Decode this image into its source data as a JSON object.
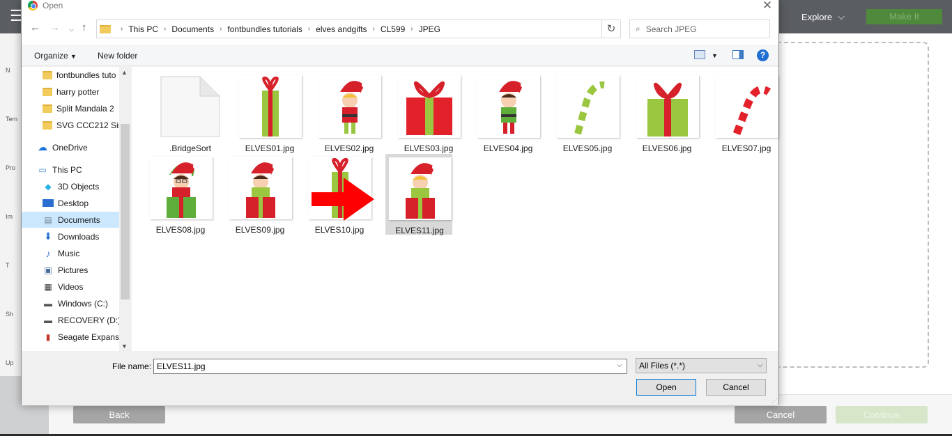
{
  "background_app": {
    "explore_label": "Explore",
    "make_it_label": "Make It",
    "sidebar_labels": [
      "N",
      "Tem",
      "Pro",
      "Im",
      "T",
      "Sh",
      "Up"
    ],
    "back_label": "Back",
    "cancel_label": "Cancel",
    "continue_label": "Continue"
  },
  "dialog": {
    "title": "Open",
    "breadcrumb": [
      "This PC",
      "Documents",
      "fontbundles tutorials",
      "elves andgifts",
      "CL599",
      "JPEG"
    ],
    "search_placeholder": "Search JPEG",
    "toolbar": {
      "organize": "Organize",
      "new_folder": "New folder"
    },
    "nav_items": [
      {
        "label": "fontbundles tuto",
        "icon": "folder-icon"
      },
      {
        "label": "harry potter",
        "icon": "folder-icon"
      },
      {
        "label": "Split Mandala 2",
        "icon": "folder-icon"
      },
      {
        "label": "SVG CCC212 Sin",
        "icon": "folder-icon"
      },
      {
        "label": "OneDrive",
        "icon": "cloud-icon"
      },
      {
        "label": "This PC",
        "icon": "computer-icon"
      },
      {
        "label": "3D Objects",
        "icon": "cube-icon"
      },
      {
        "label": "Desktop",
        "icon": "desktop-icon"
      },
      {
        "label": "Documents",
        "icon": "document-icon"
      },
      {
        "label": "Downloads",
        "icon": "download-icon"
      },
      {
        "label": "Music",
        "icon": "music-icon"
      },
      {
        "label": "Pictures",
        "icon": "picture-icon"
      },
      {
        "label": "Videos",
        "icon": "video-icon"
      },
      {
        "label": "Windows (C:)",
        "icon": "drive-icon"
      },
      {
        "label": "RECOVERY (D:)",
        "icon": "drive-icon"
      },
      {
        "label": "Seagate Expansi",
        "icon": "external-drive-icon"
      }
    ],
    "files": [
      {
        "name": ".BridgeSort",
        "kind": "blank"
      },
      {
        "name": "ELVES01.jpg",
        "kind": "gift-tall"
      },
      {
        "name": "ELVES02.jpg",
        "kind": "elf-blond"
      },
      {
        "name": "ELVES03.jpg",
        "kind": "gift-red"
      },
      {
        "name": "ELVES04.jpg",
        "kind": "elf-dark"
      },
      {
        "name": "ELVES05.jpg",
        "kind": "cane-green"
      },
      {
        "name": "ELVES06.jpg",
        "kind": "gift-green"
      },
      {
        "name": "ELVES07.jpg",
        "kind": "cane-red"
      },
      {
        "name": "ELVES08.jpg",
        "kind": "elf-gift-glasses"
      },
      {
        "name": "ELVES09.jpg",
        "kind": "elf-gift"
      },
      {
        "name": "ELVES10.jpg",
        "kind": "gift-tall"
      },
      {
        "name": "ELVES11.jpg",
        "kind": "elf-gift-blond"
      }
    ],
    "file_name_label": "File name:",
    "file_name_value": "ELVES11.jpg",
    "file_type": "All Files (*.*)",
    "open_label": "Open",
    "cancel_label": "Cancel",
    "selected_file": "ELVES11.jpg",
    "colors": {
      "selection": "#cce8ff",
      "accent": "#0078d7",
      "arrow": "#ff0000"
    }
  }
}
